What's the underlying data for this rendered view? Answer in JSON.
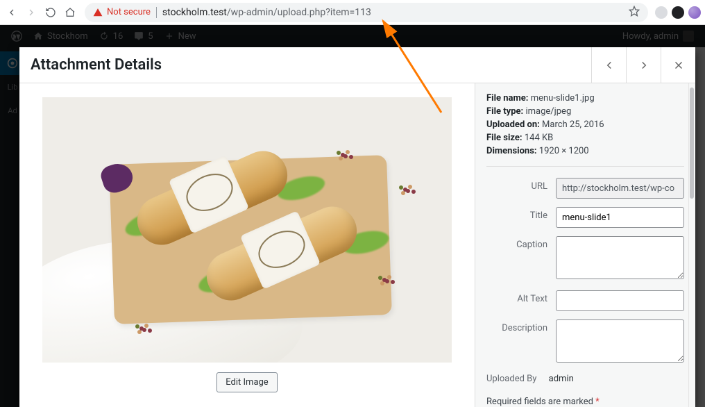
{
  "browser": {
    "not_secure": "Not secure",
    "url_host": "stockholm.test",
    "url_path": "/wp-admin/upload.php?item=113"
  },
  "adminbar": {
    "site_name": "Stockhom",
    "updates": "16",
    "comments": "5",
    "new": "New",
    "howdy": "Howdy, admin"
  },
  "leftmenu": {
    "library_short": "Lib",
    "add_short": "Ad"
  },
  "modal": {
    "title": "Attachment Details",
    "edit_image": "Edit Image"
  },
  "meta": {
    "file_name_label": "File name:",
    "file_name": "menu-slide1.jpg",
    "file_type_label": "File type:",
    "file_type": "image/jpeg",
    "uploaded_on_label": "Uploaded on:",
    "uploaded_on": "March 25, 2016",
    "file_size_label": "File size:",
    "file_size": "144 KB",
    "dimensions_label": "Dimensions:",
    "dimensions": "1920 × 1200"
  },
  "settings": {
    "url_label": "URL",
    "url_value": "http://stockholm.test/wp-co",
    "title_label": "Title",
    "title_value": "menu-slide1",
    "caption_label": "Caption",
    "caption_value": "",
    "alt_label": "Alt Text",
    "alt_value": "",
    "description_label": "Description",
    "description_value": "",
    "uploaded_by_label": "Uploaded By",
    "uploaded_by_value": "admin",
    "required_note_prefix": "Required fields are marked ",
    "required_asterisk": "*"
  }
}
